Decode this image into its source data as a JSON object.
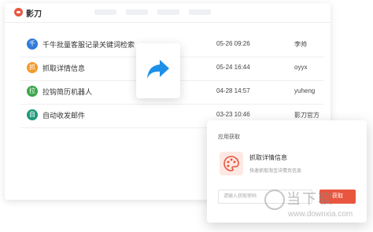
{
  "app": {
    "name": "影刀"
  },
  "rows": [
    {
      "icon": "千",
      "icon_color": "#2f7bd8",
      "name": "千牛批量客服记录关键词检索",
      "time": "05-26 09:26",
      "user": "李帅"
    },
    {
      "icon": "抓",
      "icon_color": "#f29a29",
      "name": "抓取详情信息",
      "time": "05-24 16:44",
      "user": "oyyx"
    },
    {
      "icon": "拉",
      "icon_color": "#3aa74a",
      "name": "拉钩简历机器人",
      "time": "04-28 14:57",
      "user": "yuheng"
    },
    {
      "icon": "自",
      "icon_color": "#1e9a7a",
      "name": "自动收发邮件",
      "time": "03-23 10:46",
      "user": "影刀官方"
    }
  ],
  "share_card": {
    "icon": "share-arrow-icon",
    "accent": "#1e90e8"
  },
  "popup": {
    "title": "应用获取",
    "app_name": "抓取详情信息",
    "app_desc": "快速抓取淘宝详情页信息",
    "input_placeholder": "请输入获取密码",
    "button_label": "获取"
  },
  "watermark": {
    "big": "当下软",
    "small": "www.downxia.com"
  },
  "colors": {
    "accent": "#e8563f"
  }
}
